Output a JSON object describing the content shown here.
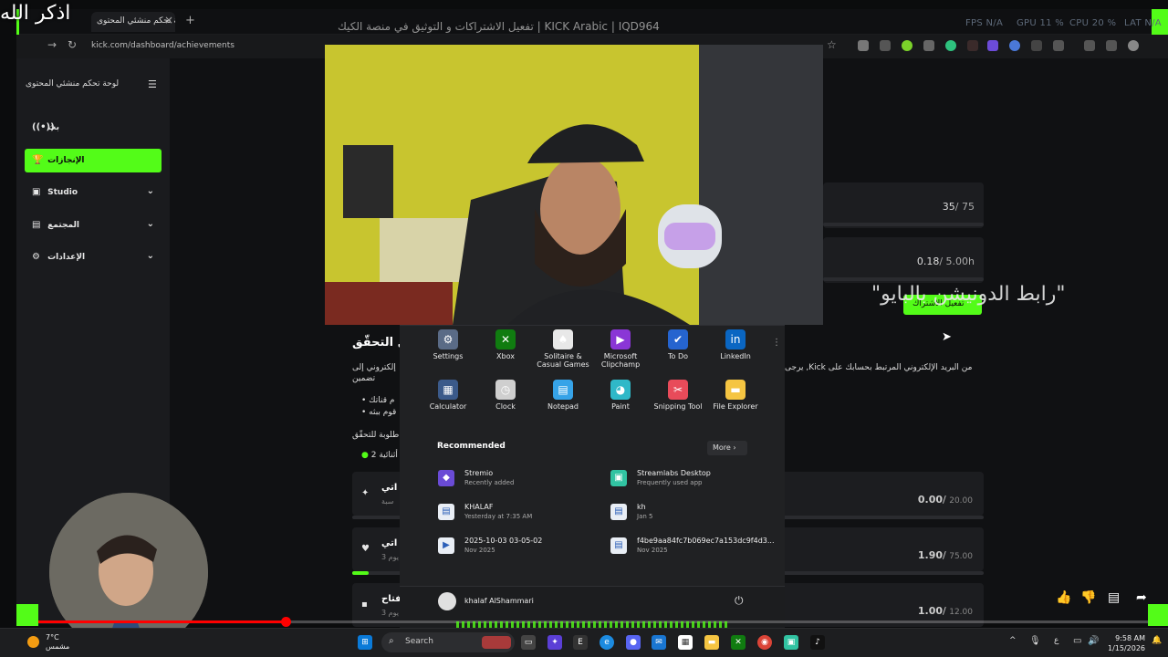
{
  "overlay": {
    "corner_text": "اذكر الله",
    "video_title": "تفعيل الاشتراكات و التوثيق في منصة الكيك | KICK Arabic | IQD964"
  },
  "browser": {
    "tab_title": "لوحة تحكم منشئي المحتوى | Kick",
    "url": "kick.com/dashboard/achievements",
    "perf": [
      "FPS N/A",
      "GPU 11 %",
      "CPU 20 %",
      "LAT N/A"
    ]
  },
  "sidebar": {
    "title": "لوحة تحكم منشئي المحتوى",
    "items": [
      {
        "label": "بث",
        "icon": "broadcast-icon"
      },
      {
        "label": "الإنجازات",
        "icon": "trophy-icon",
        "active": true
      },
      {
        "label": "Studio",
        "icon": "studio-icon"
      },
      {
        "label": "المجتمع",
        "icon": "community-icon"
      },
      {
        "label": "الإعدادات",
        "icon": "gear-icon"
      }
    ]
  },
  "achievements": {
    "cards": [
      {
        "value": "35",
        "target": "75"
      },
      {
        "value": "0.18",
        "target": "5.00h"
      }
    ],
    "button_label": "تفعيل الاشتراك",
    "watermark": "\"رابط الدونيشن بالبايو\"",
    "verify_title": "ال التحقّق",
    "verify_line": "يرجى ,Kick من البريد الإلكتروني المرتبط بحسابك على",
    "verify_left_1": "إلكتروني إلى",
    "verify_left_2": "تضمين",
    "bullet_1": "م قناتك",
    "bullet_2": "قوم ببثه",
    "required": "طلوبة للتحقّق",
    "completed": "2 أثنائية",
    "rows": [
      {
        "label": "اتي",
        "sub": "سبة",
        "value": "0.00",
        "target": "20.00"
      },
      {
        "label": "اتي",
        "sub": "3 يوم",
        "value": "1.90",
        "target": "75.00"
      },
      {
        "label": "فتاح",
        "sub": "3 يوم",
        "value": "1.00",
        "target": "12.00"
      }
    ]
  },
  "start_menu": {
    "pinned": [
      {
        "label": "Settings",
        "icon": "settings-icon",
        "color": "#5a6b86"
      },
      {
        "label": "Xbox",
        "icon": "xbox-icon",
        "color": "#107c10"
      },
      {
        "label": "Solitaire & Casual Games",
        "icon": "cards-icon",
        "color": "#e8e8e8"
      },
      {
        "label": "Microsoft Clipchamp",
        "icon": "clipchamp-icon",
        "color": "#8a36d6"
      },
      {
        "label": "To Do",
        "icon": "checkmark-icon",
        "color": "#2564cf"
      },
      {
        "label": "LinkedIn",
        "icon": "linkedin-icon",
        "color": "#0a66c2"
      },
      {
        "label": "Calculator",
        "icon": "calculator-icon",
        "color": "#3b5a8a"
      },
      {
        "label": "Clock",
        "icon": "clock-icon",
        "color": "#cfcfcf"
      },
      {
        "label": "Notepad",
        "icon": "notepad-icon",
        "color": "#36a3e8"
      },
      {
        "label": "Paint",
        "icon": "paint-icon",
        "color": "#2fb8c8"
      },
      {
        "label": "Snipping Tool",
        "icon": "scissors-icon",
        "color": "#e84b5a"
      },
      {
        "label": "File Explorer",
        "icon": "folder-icon",
        "color": "#f5c542"
      }
    ],
    "recommended_title": "Recommended",
    "more_label": "More",
    "recommended": [
      {
        "name": "Stremio",
        "sub": "Recently added",
        "icon": "stremio-icon",
        "color": "#6a4bd6"
      },
      {
        "name": "Streamlabs Desktop",
        "sub": "Frequently used app",
        "icon": "streamlabs-icon",
        "color": "#31c3a2"
      },
      {
        "name": "KHALAF",
        "sub": "Yesterday at 7:35 AM",
        "icon": "document-icon",
        "color": "#e9eef5"
      },
      {
        "name": "kh",
        "sub": "Jan 5",
        "icon": "document-icon",
        "color": "#e9eef5"
      },
      {
        "name": "2025-10-03 03-05-02",
        "sub": "Nov 2025",
        "icon": "video-file-icon",
        "color": "#e9eef5"
      },
      {
        "name": "f4be9aa84fc7b069ec7a153dc9f4d3...",
        "sub": "Nov 2025",
        "icon": "document-icon",
        "color": "#e9eef5"
      }
    ],
    "user_name": "khalaf AlShammari"
  },
  "taskbar": {
    "weather_temp": "7°C",
    "weather_desc": "مشمس",
    "search_placeholder": "Search",
    "time": "9:58 AM",
    "date": "1/15/2026",
    "lang": "ع"
  }
}
